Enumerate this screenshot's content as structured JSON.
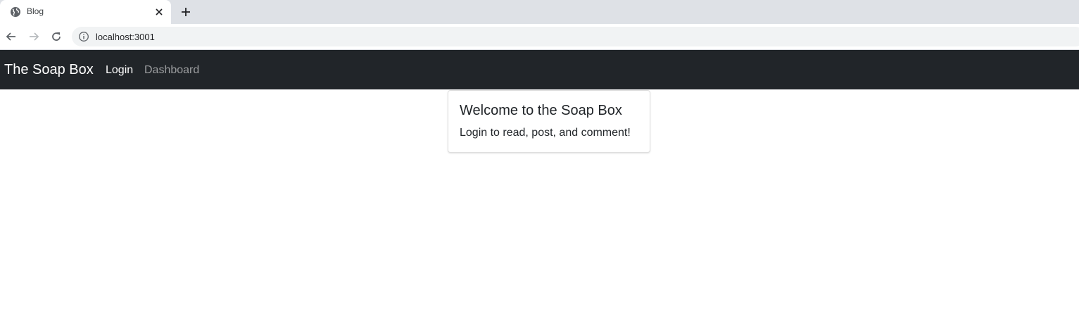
{
  "browser": {
    "tab": {
      "title": "Blog",
      "favicon": "globe-icon"
    },
    "new_tab_icon": "plus-icon",
    "address_bar": {
      "url": "localhost:3001",
      "security_icon": "info-icon"
    }
  },
  "navbar": {
    "brand": "The Soap Box",
    "links": [
      {
        "label": "Login",
        "active": true
      },
      {
        "label": "Dashboard",
        "active": false
      }
    ],
    "background": "#212529"
  },
  "card": {
    "title": "Welcome to the Soap Box",
    "text": "Login to read, post, and comment!"
  }
}
